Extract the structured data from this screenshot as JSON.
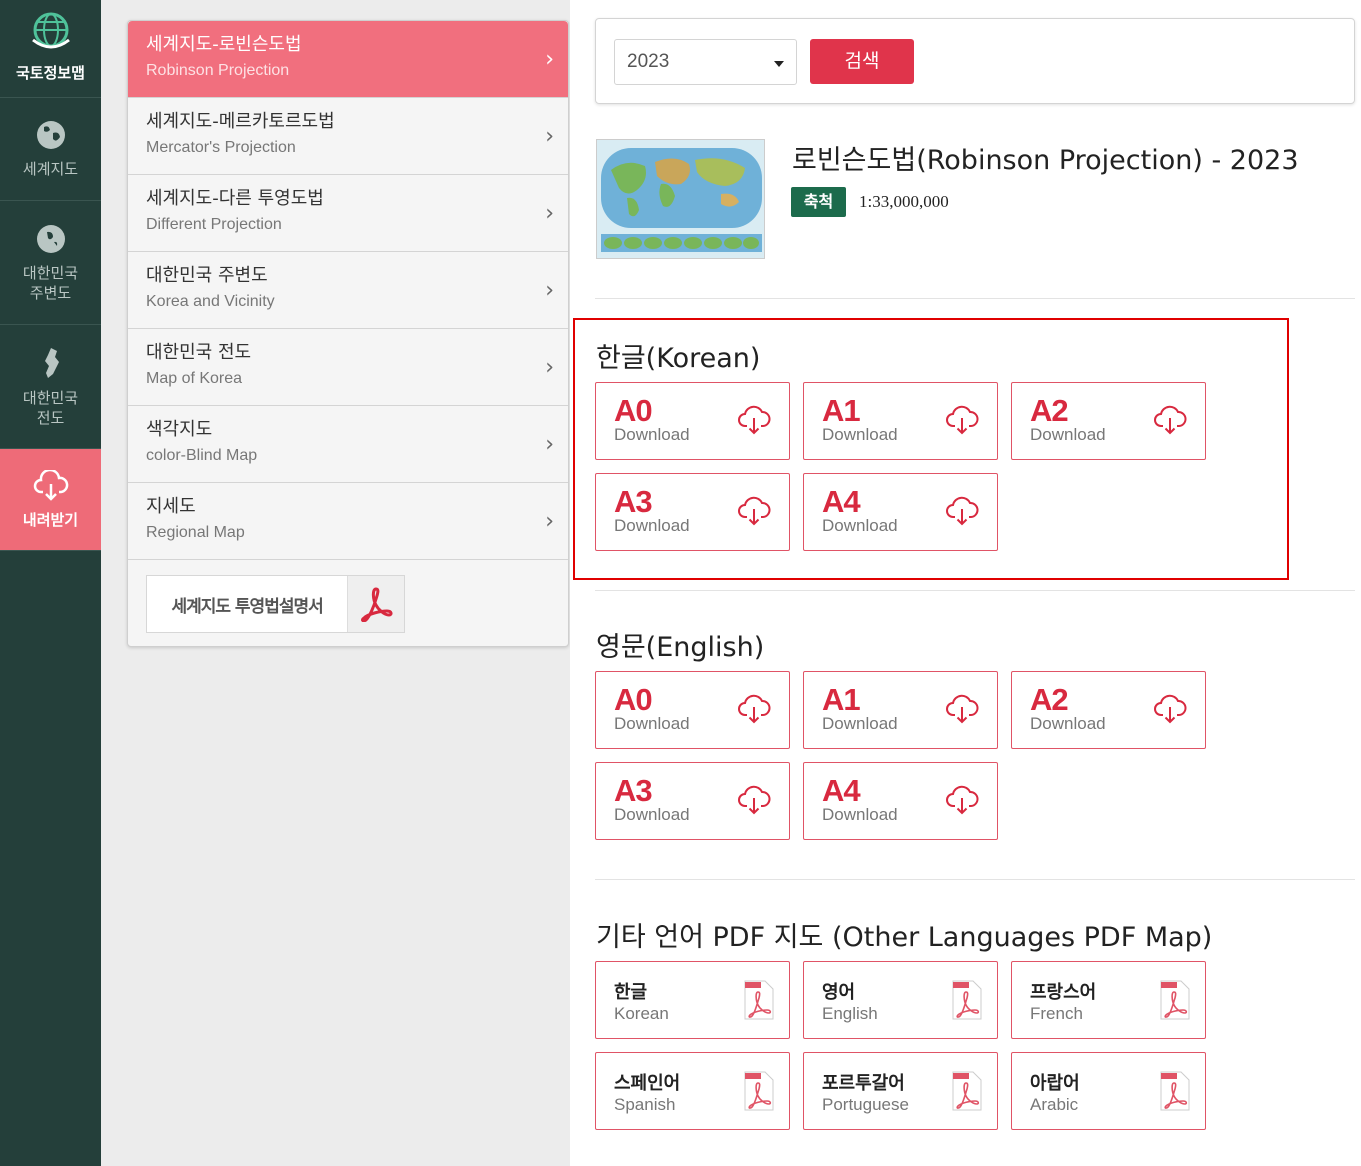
{
  "sidebar": {
    "logo_label": "국토정보맵",
    "items": [
      {
        "label": "세계지도",
        "icon": "globe-icon"
      },
      {
        "label": "대한민국\n주변도",
        "icon": "globe-vicinity-icon"
      },
      {
        "label": "대한민국\n전도",
        "icon": "korea-map-icon"
      },
      {
        "label": "내려받기",
        "icon": "cloud-download-icon",
        "active": true
      }
    ]
  },
  "menu": {
    "items": [
      {
        "ko": "세계지도-로빈슨도법",
        "en": "Robinson Projection",
        "active": true
      },
      {
        "ko": "세계지도-메르카토르도법",
        "en": "Mercator's Projection"
      },
      {
        "ko": "세계지도-다른 투영도법",
        "en": "Different Projection"
      },
      {
        "ko": "대한민국 주변도",
        "en": "Korea and Vicinity"
      },
      {
        "ko": "대한민국 전도",
        "en": "Map of Korea"
      },
      {
        "ko": "색각지도",
        "en": "color-Blind Map"
      },
      {
        "ko": "지세도",
        "en": "Regional Map"
      }
    ],
    "manual_label": "세계지도 투영법설명서"
  },
  "search": {
    "year": "2023",
    "button_label": "검색"
  },
  "map": {
    "title": "로빈슨도법(Robinson Projection) - 2023",
    "scale_label": "축척",
    "scale_value": "1:33,000,000"
  },
  "sections": {
    "korean": {
      "title": "한글(Korean)",
      "items": [
        {
          "code": "A0",
          "sub": "Download"
        },
        {
          "code": "A1",
          "sub": "Download"
        },
        {
          "code": "A2",
          "sub": "Download"
        },
        {
          "code": "A3",
          "sub": "Download"
        },
        {
          "code": "A4",
          "sub": "Download"
        }
      ]
    },
    "english": {
      "title": "영문(English)",
      "items": [
        {
          "code": "A0",
          "sub": "Download"
        },
        {
          "code": "A1",
          "sub": "Download"
        },
        {
          "code": "A2",
          "sub": "Download"
        },
        {
          "code": "A3",
          "sub": "Download"
        },
        {
          "code": "A4",
          "sub": "Download"
        }
      ]
    },
    "other": {
      "title": "기타 언어 PDF 지도 (Other Languages PDF Map)",
      "items": [
        {
          "ko": "한글",
          "en": "Korean"
        },
        {
          "ko": "영어",
          "en": "English"
        },
        {
          "ko": "프랑스어",
          "en": "French"
        },
        {
          "ko": "스페인어",
          "en": "Spanish"
        },
        {
          "ko": "포르투갈어",
          "en": "Portuguese"
        },
        {
          "ko": "아랍어",
          "en": "Arabic"
        }
      ]
    }
  },
  "colors": {
    "sidebar_bg": "#243f3a",
    "accent": "#e0344b",
    "menu_active": "#f16f7e",
    "scale_badge": "#1c6b4c",
    "highlight": "#e00000"
  }
}
